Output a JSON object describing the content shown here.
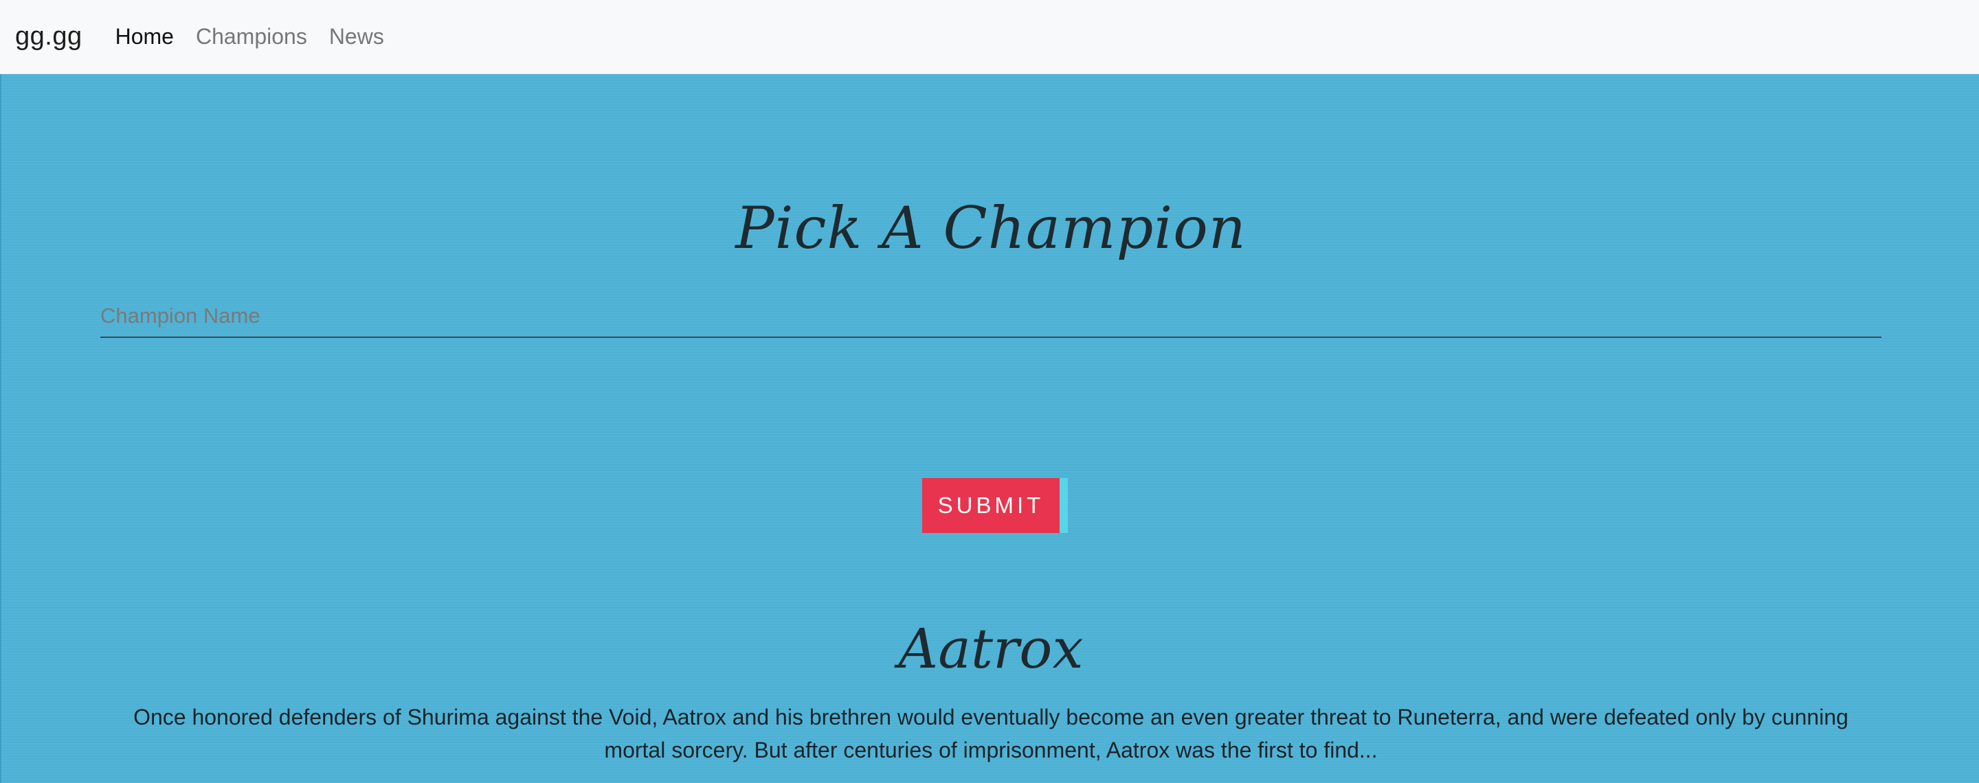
{
  "navbar": {
    "brand": "gg.gg",
    "links": [
      {
        "label": "Home",
        "active": true
      },
      {
        "label": "Champions",
        "active": false
      },
      {
        "label": "News",
        "active": false
      }
    ]
  },
  "main": {
    "title": "Pick A Champion",
    "search": {
      "placeholder": "Champion Name",
      "value": ""
    },
    "submit_label": "Submit",
    "champion": {
      "name": "Aatrox",
      "lore": "Once honored defenders of Shurima against the Void, Aatrox and his brethren would eventually become an even greater threat to Runeterra, and were defeated only by cunning mortal sorcery. But after centuries of imprisonment, Aatrox was the first to find..."
    }
  },
  "colors": {
    "navbar_bg": "#f8f9fa",
    "hero_bg": "#4fb3d6",
    "submit_bg": "#e8344e",
    "submit_accent": "#58d6e8",
    "text_dark": "#1e2a2f"
  }
}
